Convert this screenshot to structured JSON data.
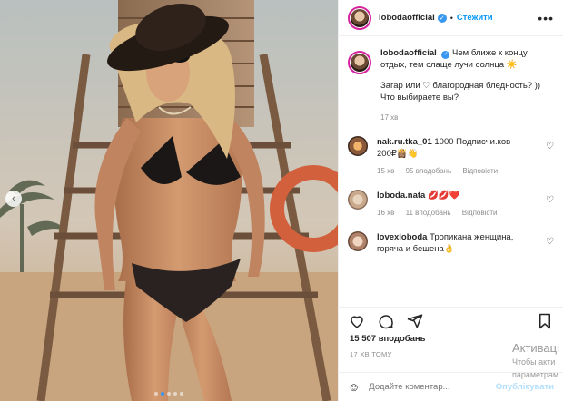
{
  "post": {
    "username": "lobodaofficial",
    "follow_label": "Стежити",
    "more_label": "•••",
    "caption_line1": "Чем ближе к концу отдых, тем слаще лучи солнца ☀️",
    "caption_line2": "Загар или ♡ благородная бледность? ))",
    "caption_line3": "Что выбираете вы?",
    "caption_time": "17 хв"
  },
  "comments": [
    {
      "username": "nak.ru.tka_01",
      "text": "1000 Подписчи.ков 200₽👸🏽👋",
      "time": "15 хв",
      "likes": "95 вподобань",
      "reply": "Відповісти",
      "avatar_color": "#8a5a3a"
    },
    {
      "username": "loboda.nata",
      "text": "💋💋❤️",
      "time": "16 хв",
      "likes": "11 вподобань",
      "reply": "Відповісти",
      "avatar_color": "#c9a98c"
    },
    {
      "username": "lovexloboda",
      "text": "Тропикана женщина, горяча и бешена👌",
      "time": "",
      "likes": "",
      "reply": "",
      "avatar_color": "#b0826a"
    }
  ],
  "stats": {
    "likes": "15 507 вподобань",
    "time": "17 ХВ ТОМУ"
  },
  "add_comment": {
    "placeholder": "Додайте коментар...",
    "publish": "Опублікувати",
    "emoji": "☺"
  },
  "watermark": {
    "line1": "Активаці",
    "line2": "Чтобы акти",
    "line3": "параметрам"
  },
  "icons": {
    "heart": "heart-icon",
    "comment": "comment-icon",
    "share": "share-icon",
    "save": "bookmark-icon",
    "prev": "chevron-left-icon"
  },
  "colors": {
    "accent": "#0095f6",
    "verified": "#3897f0",
    "story_ring": "#d6249f"
  },
  "carousel": {
    "slides": 5,
    "active": 1
  }
}
